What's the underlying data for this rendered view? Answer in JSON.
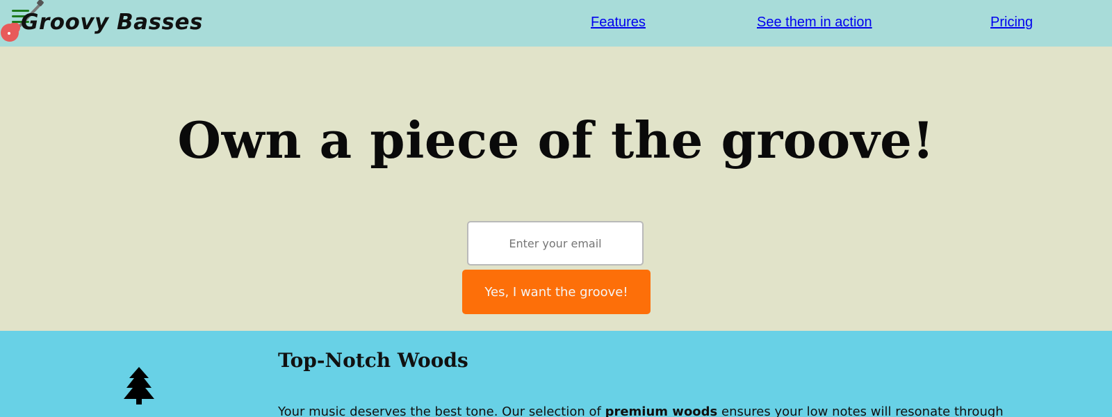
{
  "nav": {
    "brand": "Groovy Basses",
    "links": [
      {
        "label": "Features"
      },
      {
        "label": "See them in action"
      },
      {
        "label": "Pricing"
      }
    ]
  },
  "hero": {
    "title": "Own a piece of the groove!",
    "email_placeholder": "Enter your email",
    "cta_label": "Yes, I want the groove!"
  },
  "features": {
    "items": [
      {
        "icon": "tree-icon",
        "title": "Top-Notch Woods",
        "text_before": "Your music deserves the best tone. Our selection of ",
        "text_bold": "premium woods",
        "text_after": " ensures your low notes will resonate through"
      }
    ]
  },
  "colors": {
    "nav_bg": "#a8dcd9",
    "hero_bg": "#e1e3c9",
    "cta_bg": "#fd6f09",
    "features_bg": "#68d1e6",
    "link": "#0000ee"
  }
}
